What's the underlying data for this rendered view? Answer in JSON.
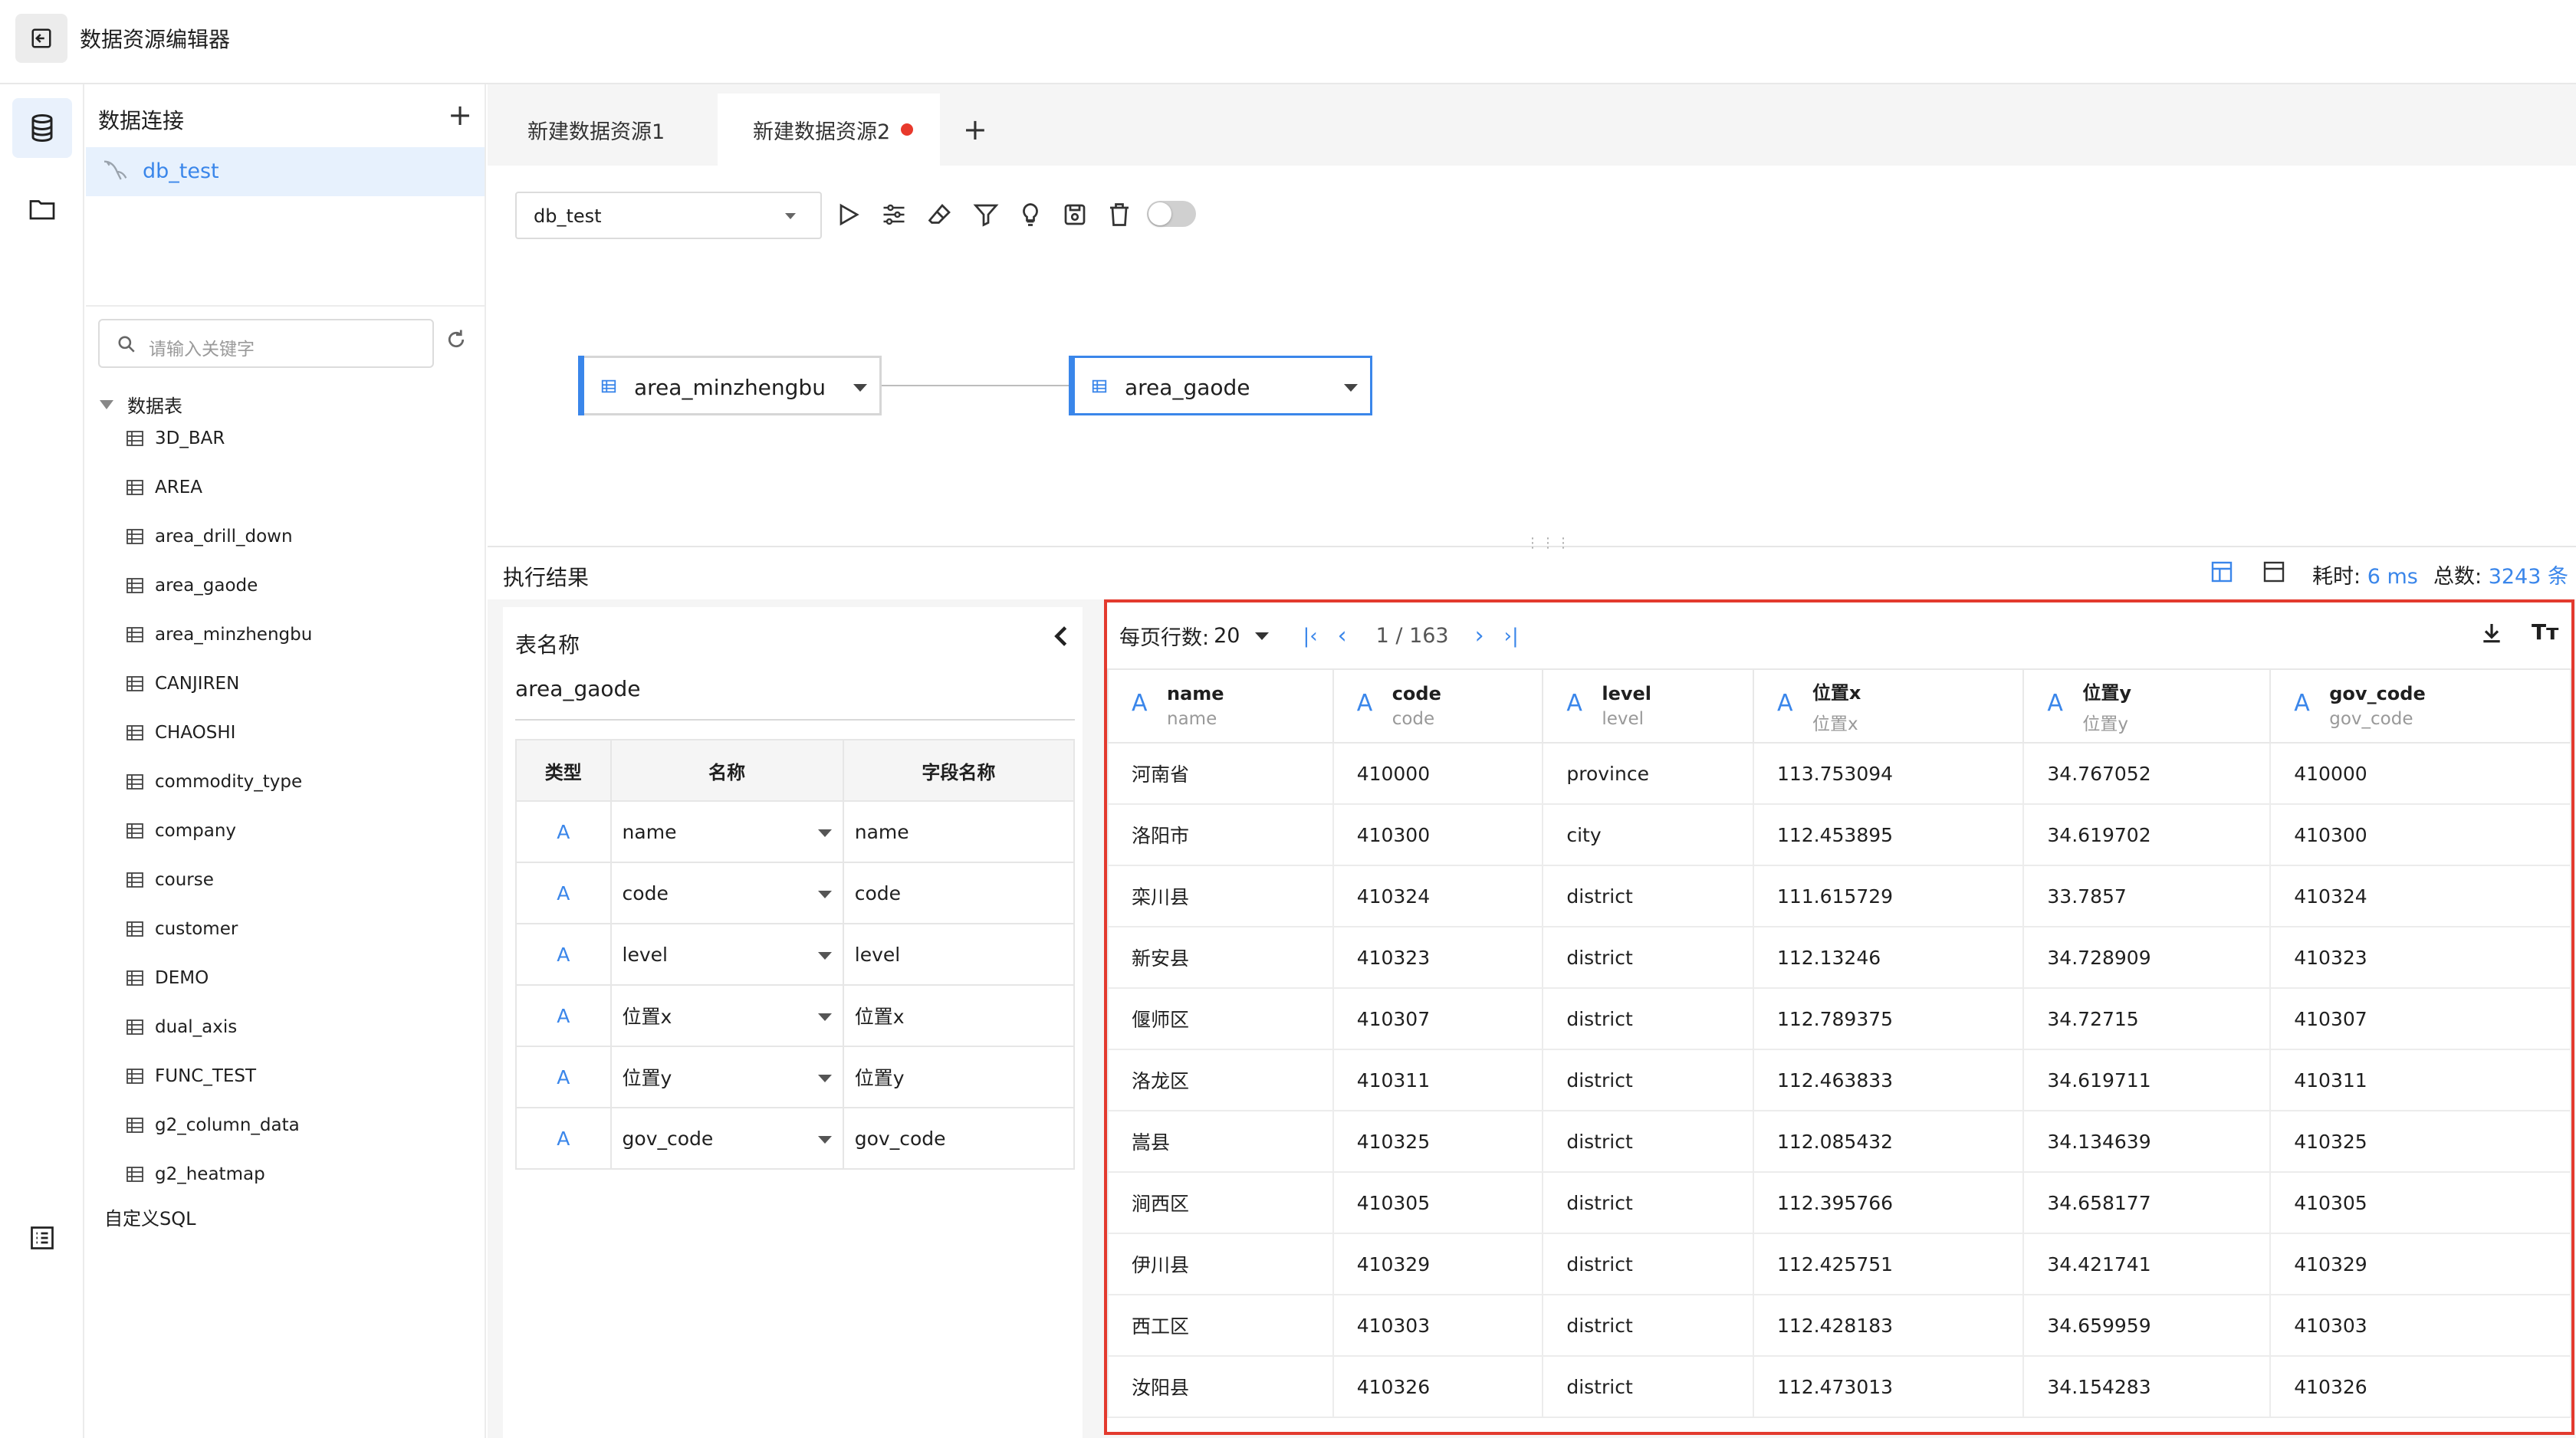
{
  "app": {
    "title": "数据资源编辑器"
  },
  "left": {
    "connections_title": "数据连接",
    "connection": "db_test",
    "search_placeholder": "请输入关键字",
    "tables_group": "数据表",
    "tables": [
      "3D_BAR",
      "AREA",
      "area_drill_down",
      "area_gaode",
      "area_minzhengbu",
      "CANJIREN",
      "CHAOSHI",
      "commodity_type",
      "company",
      "course",
      "customer",
      "DEMO",
      "dual_axis",
      "FUNC_TEST",
      "g2_column_data",
      "g2_heatmap"
    ],
    "custom_sql": "自定义SQL"
  },
  "tabs": [
    "新建数据资源1",
    "新建数据资源2"
  ],
  "toolbar": {
    "datasource": "db_test"
  },
  "flow": {
    "nodes": [
      "area_minzhengbu",
      "area_gaode"
    ]
  },
  "results": {
    "title": "执行结果",
    "timing_label": "耗时: ",
    "timing_value": "6 ms",
    "total_label": "总数: ",
    "total_value": "3243 条",
    "table_name_label": "表名称",
    "table_name": "area_gaode",
    "field_headers": [
      "类型",
      "名称",
      "字段名称"
    ],
    "fields": [
      {
        "type": "A",
        "name": "name",
        "field": "name"
      },
      {
        "type": "A",
        "name": "code",
        "field": "code"
      },
      {
        "type": "A",
        "name": "level",
        "field": "level"
      },
      {
        "type": "A",
        "name": "位置x",
        "field": "位置x"
      },
      {
        "type": "A",
        "name": "位置y",
        "field": "位置y"
      },
      {
        "type": "A",
        "name": "gov_code",
        "field": "gov_code"
      }
    ],
    "page_size_label": "每页行数: ",
    "page_size": "20",
    "page_info": "1 / 163",
    "columns": [
      {
        "title": "name",
        "sub": "name"
      },
      {
        "title": "code",
        "sub": "code"
      },
      {
        "title": "level",
        "sub": "level"
      },
      {
        "title": "位置x",
        "sub": "位置x"
      },
      {
        "title": "位置y",
        "sub": "位置y"
      },
      {
        "title": "gov_code",
        "sub": "gov_code"
      }
    ],
    "rows": [
      [
        "河南省",
        "410000",
        "province",
        "113.753094",
        "34.767052",
        "410000"
      ],
      [
        "洛阳市",
        "410300",
        "city",
        "112.453895",
        "34.619702",
        "410300"
      ],
      [
        "栾川县",
        "410324",
        "district",
        "111.615729",
        "33.7857",
        "410324"
      ],
      [
        "新安县",
        "410323",
        "district",
        "112.13246",
        "34.728909",
        "410323"
      ],
      [
        "偃师区",
        "410307",
        "district",
        "112.789375",
        "34.72715",
        "410307"
      ],
      [
        "洛龙区",
        "410311",
        "district",
        "112.463833",
        "34.619711",
        "410311"
      ],
      [
        "嵩县",
        "410325",
        "district",
        "112.085432",
        "34.134639",
        "410325"
      ],
      [
        "涧西区",
        "410305",
        "district",
        "112.395766",
        "34.658177",
        "410305"
      ],
      [
        "伊川县",
        "410329",
        "district",
        "112.425751",
        "34.421741",
        "410329"
      ],
      [
        "西工区",
        "410303",
        "district",
        "112.428183",
        "34.659959",
        "410303"
      ],
      [
        "汝阳县",
        "410326",
        "district",
        "112.473013",
        "34.154283",
        "410326"
      ]
    ]
  },
  "colors": {
    "accent": "#3a86ea",
    "highlight_border": "#e33a2e",
    "unsaved_dot": "#e8392c"
  }
}
